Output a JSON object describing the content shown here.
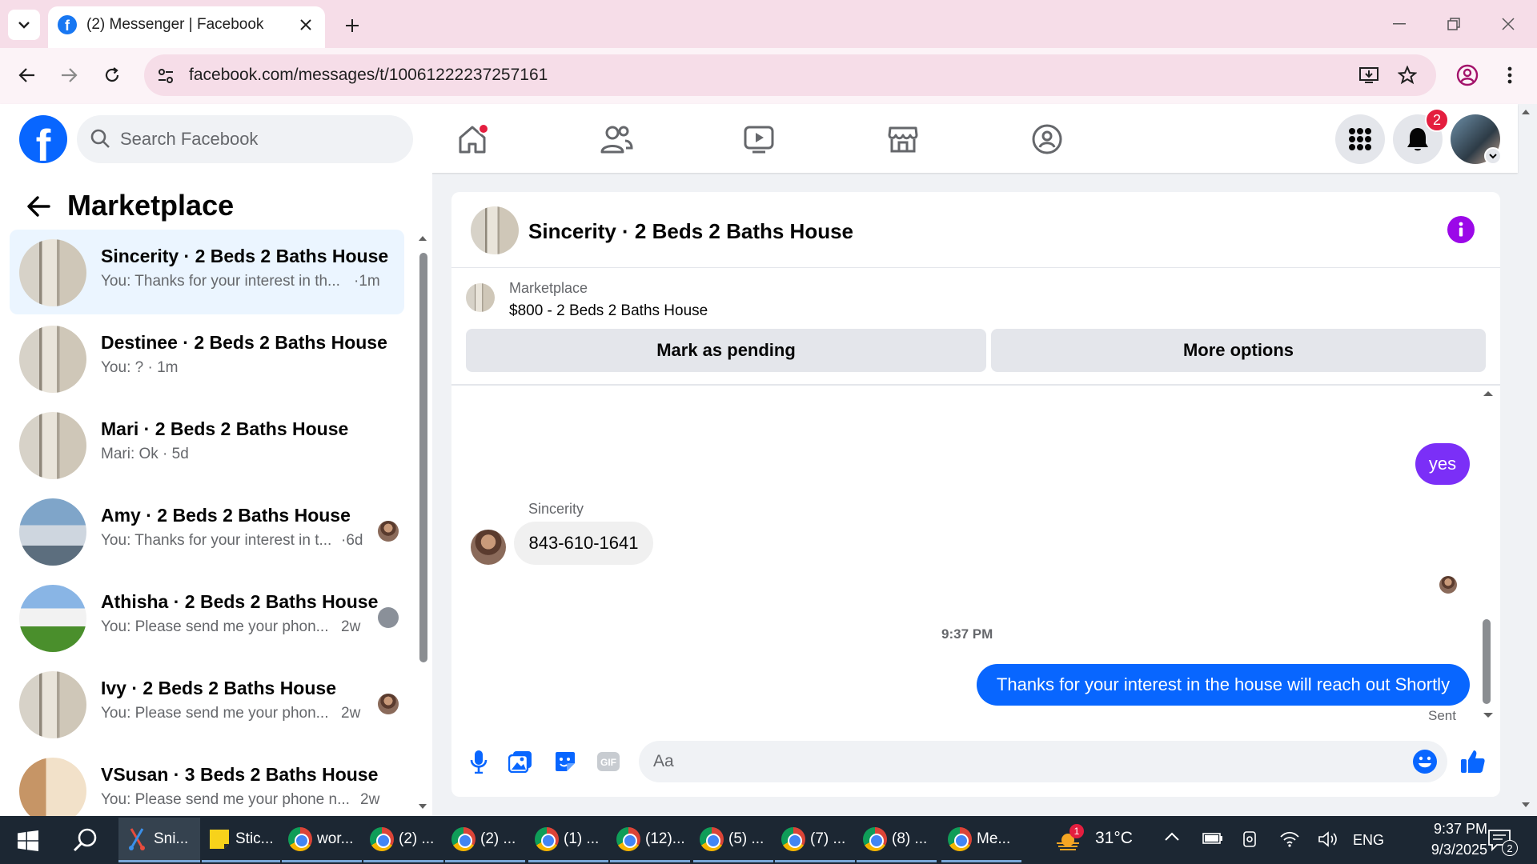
{
  "browser": {
    "tab_title": "(2) Messenger | Facebook",
    "url": "facebook.com/messages/t/10061222237257161"
  },
  "fb": {
    "logo_letter": "f",
    "search_placeholder": "Search Facebook",
    "notification_count": "2"
  },
  "sidebar": {
    "title": "Marketplace",
    "conversations": [
      {
        "name": "Sincerity · 2 Beds 2 Baths House",
        "preview": "You: Thanks for your interest in th...",
        "time": "·1m",
        "image": "house-interior"
      },
      {
        "name": "Destinee · 2 Beds 2 Baths House",
        "preview": "You: ? · 1m",
        "time": "",
        "image": "house-interior"
      },
      {
        "name": "Mari · 2 Beds 2 Baths House",
        "preview": "Mari: Ok · 5d",
        "time": "",
        "image": "house-interior"
      },
      {
        "name": "Amy · 2 Beds 2 Baths House",
        "preview": "You: Thanks for your interest in t...",
        "time": "·6d",
        "image": "house-exterior"
      },
      {
        "name": "Athisha · 2 Beds 2 Baths House",
        "preview": "You: Please send me your phon...",
        "time": "2w",
        "image": "house-lawn"
      },
      {
        "name": "Ivy · 2 Beds 2 Baths House",
        "preview": "You: Please send me your phon...",
        "time": "2w",
        "image": "house-interior"
      },
      {
        "name": "VSusan · 3 Beds 2 Baths House",
        "preview": "You: Please send me your phone n...",
        "time": "2w",
        "image": "room"
      }
    ]
  },
  "chat": {
    "title": "Sincerity · 2 Beds 2 Baths House",
    "listing_source": "Marketplace",
    "listing_title": "$800 - 2 Beds 2 Baths House",
    "mark_pending_label": "Mark as pending",
    "more_options_label": "More options",
    "messages": {
      "outgoing_1": "yes",
      "sender_name": "Sincerity",
      "incoming_1": "843-610-1641",
      "timestamp": "9:37 PM",
      "outgoing_2": "Thanks for your interest in the house will reach out Shortly",
      "status": "Sent"
    },
    "composer_placeholder": "Aa"
  },
  "taskbar": {
    "items": [
      {
        "label": "Sni...",
        "icon": "snipping-tool-icon"
      },
      {
        "label": "Stic...",
        "icon": "sticky-notes-icon"
      },
      {
        "label": "wor...",
        "icon": "chrome-icon"
      },
      {
        "label": "(2) ...",
        "icon": "chrome-icon"
      },
      {
        "label": "(2) ...",
        "icon": "chrome-icon"
      },
      {
        "label": "(1) ...",
        "icon": "chrome-icon"
      },
      {
        "label": "(12)...",
        "icon": "chrome-icon"
      },
      {
        "label": "(5) ...",
        "icon": "chrome-icon"
      },
      {
        "label": "(7) ...",
        "icon": "chrome-icon"
      },
      {
        "label": "(8) ...",
        "icon": "chrome-icon"
      },
      {
        "label": "Me...",
        "icon": "chrome-icon"
      }
    ],
    "weather_badge": "1",
    "temperature": "31°C",
    "language": "ENG",
    "time": "9:37 PM",
    "date": "9/3/2025",
    "notification_count": "2"
  },
  "colors": {
    "fb_blue": "#0866ff",
    "purple_bubble": "#7b2ff7",
    "badge_red": "#e41e3f"
  }
}
